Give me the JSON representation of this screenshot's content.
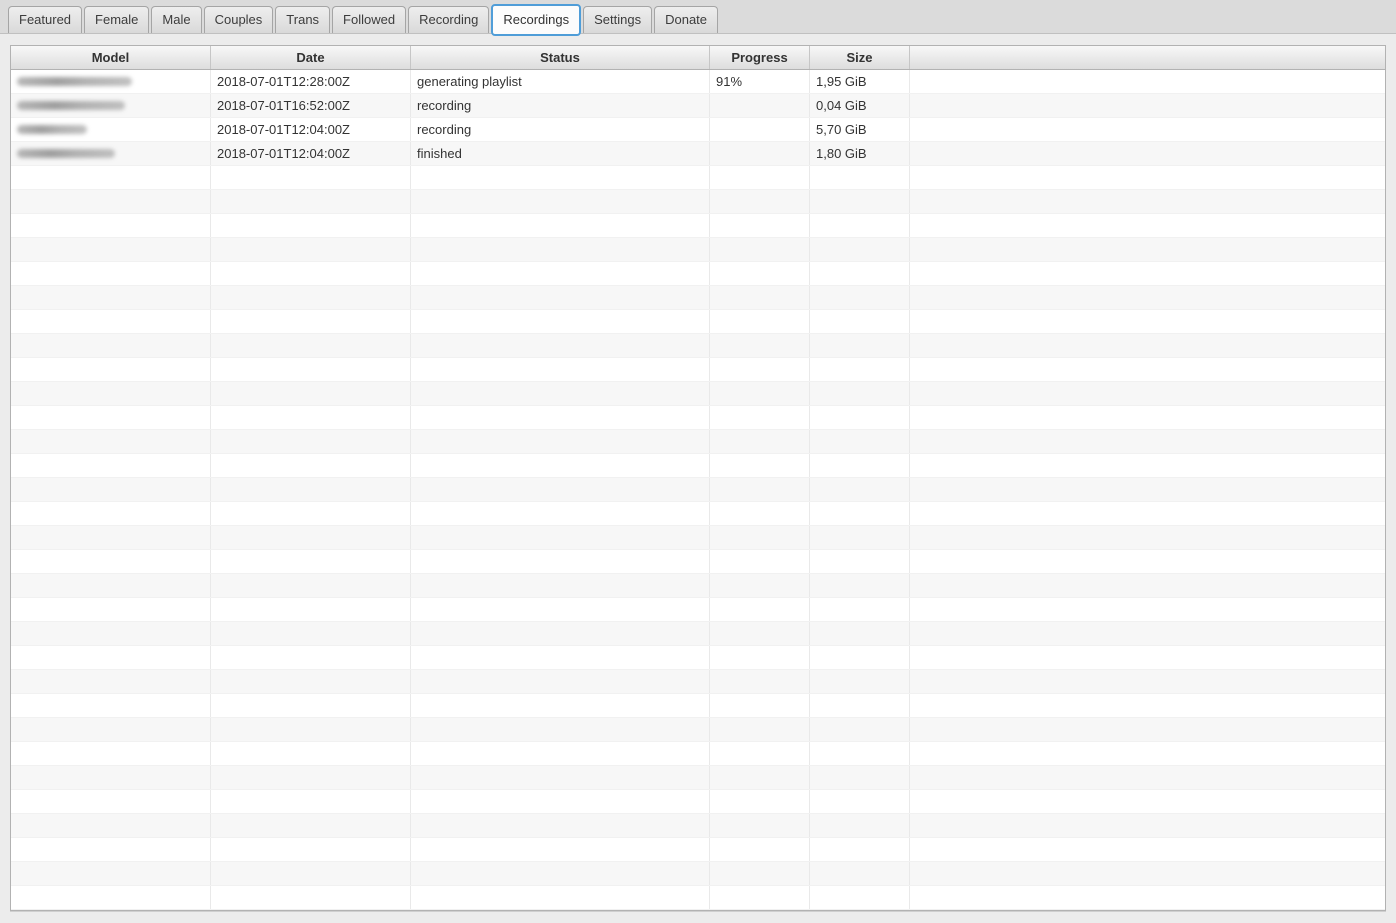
{
  "accent_color": "#4f9dd8",
  "tabs": [
    {
      "label": "Featured",
      "active": false
    },
    {
      "label": "Female",
      "active": false
    },
    {
      "label": "Male",
      "active": false
    },
    {
      "label": "Couples",
      "active": false
    },
    {
      "label": "Trans",
      "active": false
    },
    {
      "label": "Followed",
      "active": false
    },
    {
      "label": "Recording",
      "active": false
    },
    {
      "label": "Recordings",
      "active": true
    },
    {
      "label": "Settings",
      "active": false
    },
    {
      "label": "Donate",
      "active": false
    }
  ],
  "table": {
    "columns": [
      "Model",
      "Date",
      "Status",
      "Progress",
      "Size",
      ""
    ],
    "rows": [
      {
        "model": "",
        "model_redacted": true,
        "model_blur_width": 115,
        "date": "2018-07-01T12:28:00Z",
        "status": "generating playlist",
        "progress": "91%",
        "size": "1,95 GiB"
      },
      {
        "model": "",
        "model_redacted": true,
        "model_blur_width": 108,
        "date": "2018-07-01T16:52:00Z",
        "status": "recording",
        "progress": "",
        "size": "0,04 GiB"
      },
      {
        "model": "",
        "model_redacted": true,
        "model_blur_width": 70,
        "date": "2018-07-01T12:04:00Z",
        "status": "recording",
        "progress": "",
        "size": "5,70 GiB"
      },
      {
        "model": "",
        "model_redacted": true,
        "model_blur_width": 98,
        "date": "2018-07-01T12:04:00Z",
        "status": "finished",
        "progress": "",
        "size": "1,80 GiB"
      }
    ],
    "empty_rows": 31
  }
}
